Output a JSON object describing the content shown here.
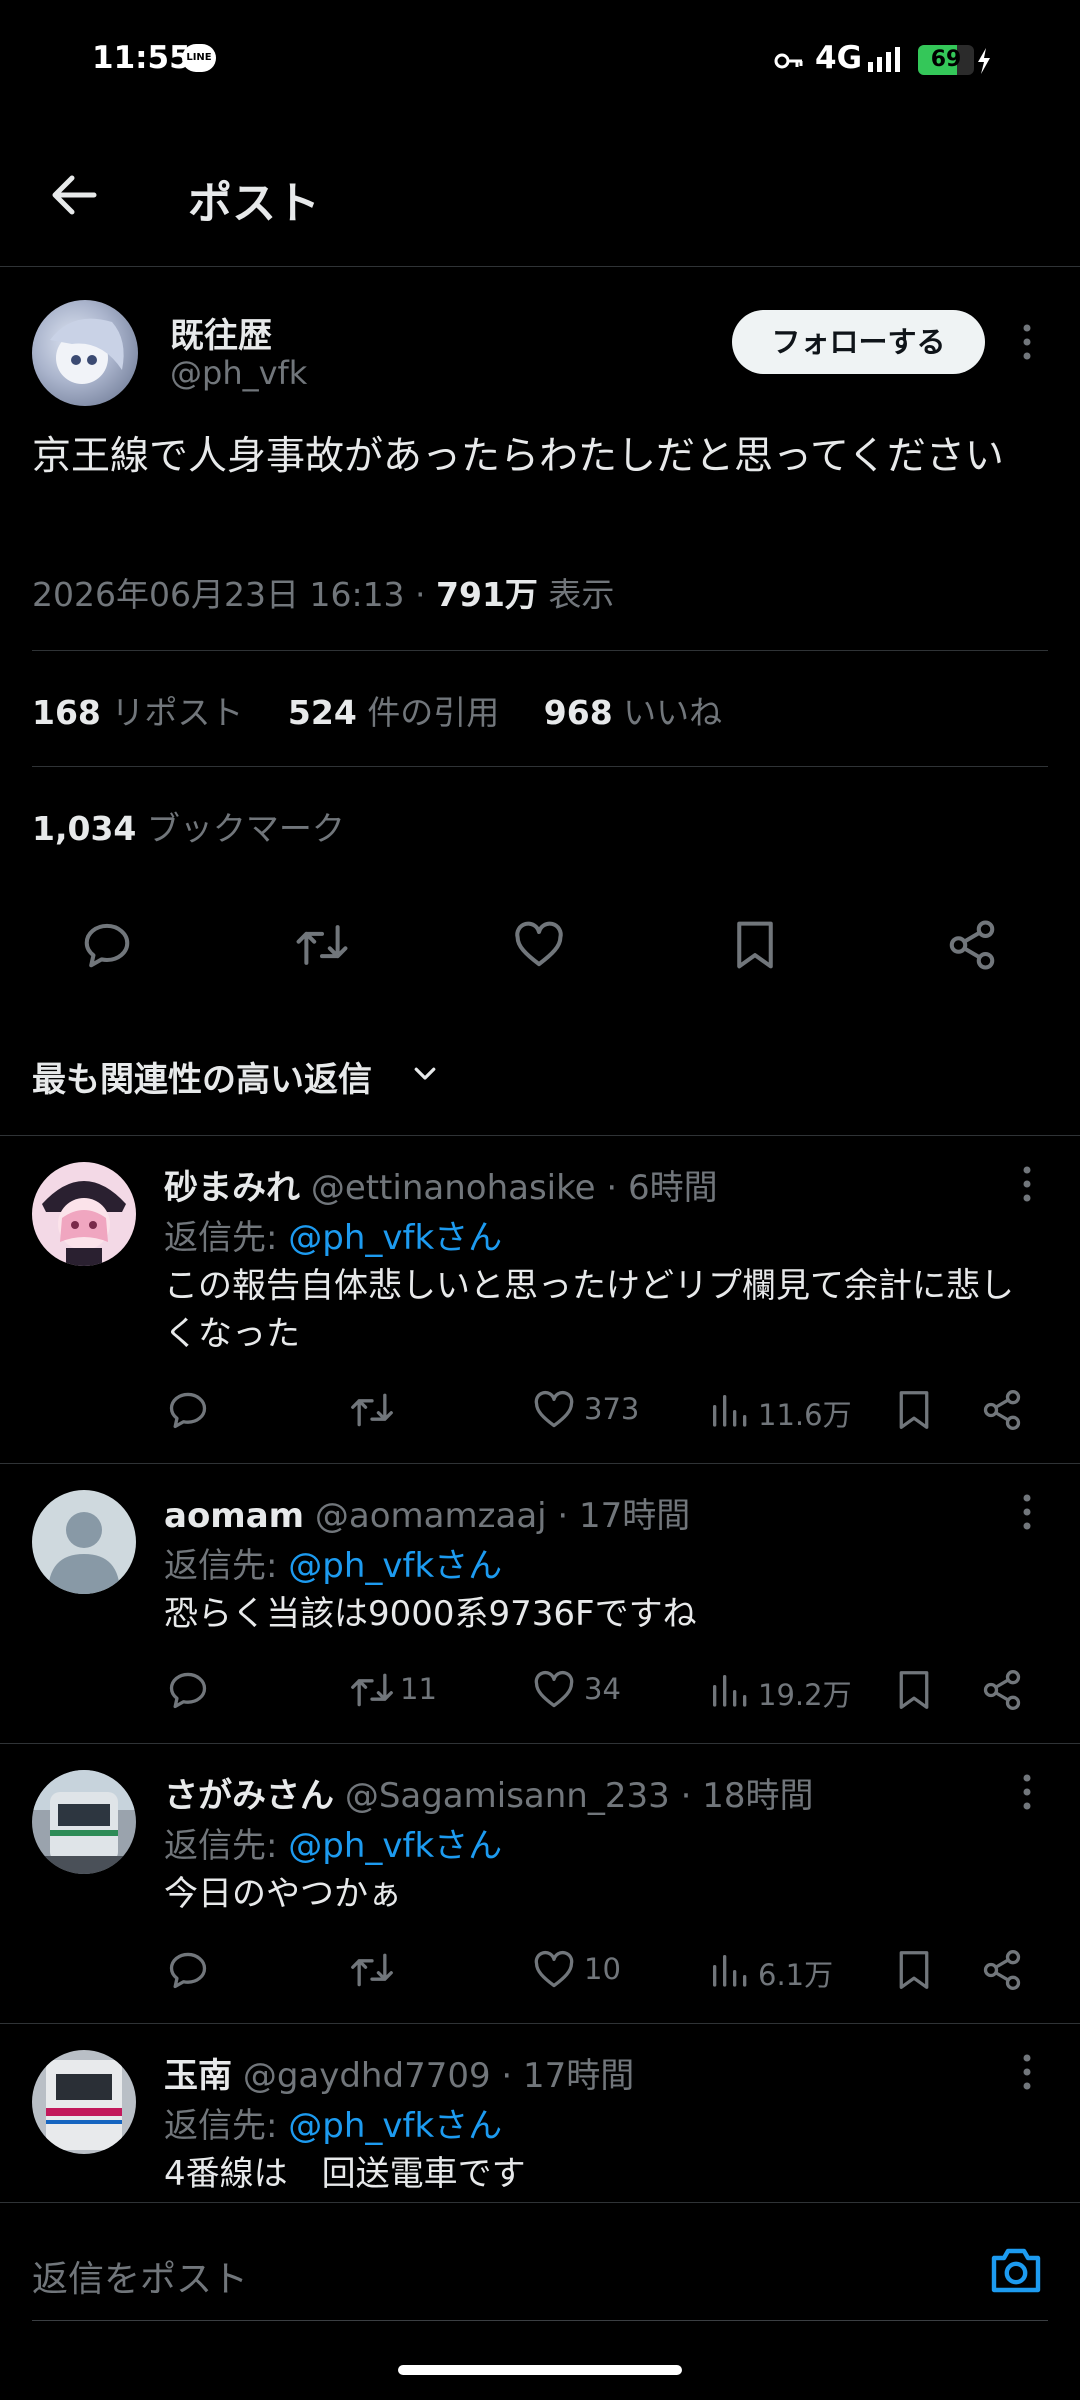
{
  "status_bar": {
    "time": "11:55",
    "line_badge": "LINE",
    "network": "4G",
    "battery": "69",
    "battery_level": 0.69
  },
  "header": {
    "title": "ポスト"
  },
  "post": {
    "display_name": "既往歴",
    "handle": "@ph_vfk",
    "follow_label": "フォローする",
    "text": "京王線で人身事故があったらわたしだと思ってください",
    "timestamp": "2026年06月23日 16:13",
    "separator": " · ",
    "views": "791万",
    "views_label": " 表示",
    "reposts": "168",
    "reposts_label": " リポスト",
    "quotes": "524",
    "quotes_label": " 件の引用",
    "likes": "968",
    "likes_label": " いいね",
    "bookmarks": "1,034",
    "bookmarks_label": " ブックマーク"
  },
  "sort_label": "最も関連性の高い返信",
  "replying_prefix": "返信先: ",
  "replies": [
    {
      "name": "砂まみれ",
      "handle": "@ettinanohasike",
      "time": "· 6時間",
      "reply_to": "@ph_vfkさん",
      "text": "この報告自体悲しいと思ったけどリプ欄見て余計に悲しくなった",
      "reposts": "",
      "likes": "373",
      "views": "11.6万"
    },
    {
      "name": "aomam",
      "handle": "@aomamzaaj",
      "time": "· 17時間",
      "reply_to": "@ph_vfkさん",
      "text": "恐らく当該は9000系9736Fですね",
      "reposts": "11",
      "likes": "34",
      "views": "19.2万"
    },
    {
      "name": "さがみさん",
      "handle": "@Sagamisann_233",
      "time": "· 18時間",
      "reply_to": "@ph_vfkさん",
      "text": "今日のやつかぁ",
      "reposts": "",
      "likes": "10",
      "views": "6.1万"
    },
    {
      "name": "玉南",
      "handle": "@gaydhd7709",
      "time": "· 17時間",
      "reply_to": "@ph_vfkさん",
      "text": "4番線は　回送電車です"
    }
  ],
  "composer": {
    "placeholder": "返信をポスト"
  },
  "colors": {
    "background": "#000000",
    "accent": "#1d9bf0",
    "muted": "#71767b",
    "text": "#e7e9ea",
    "divider": "#2f3336"
  }
}
